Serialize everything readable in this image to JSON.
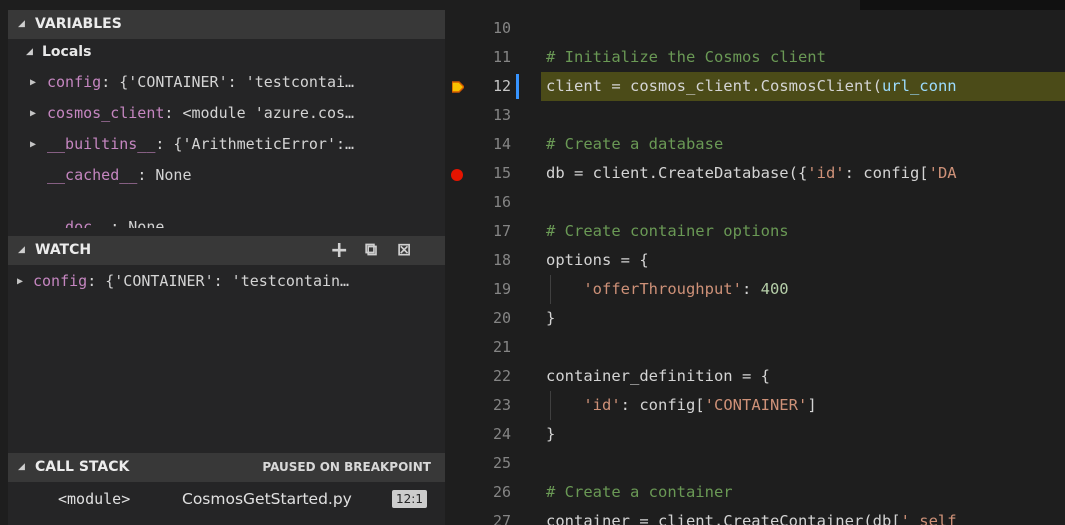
{
  "sidebar": {
    "variables": {
      "title": "VARIABLES",
      "locals_title": "Locals",
      "rows": [
        {
          "name": "config",
          "value": ": {'CONTAINER': 'testcontai…",
          "expandable": true
        },
        {
          "name": "cosmos_client",
          "value": ": <module 'azure.cos…",
          "expandable": true
        },
        {
          "name": "__builtins__",
          "value": ": {'ArithmeticError':…",
          "expandable": true
        },
        {
          "name": "__cached__",
          "value": ": None",
          "expandable": false
        },
        {
          "name": "__doc__",
          "value": ": None",
          "expandable": false
        }
      ]
    },
    "watch": {
      "title": "WATCH",
      "add_icon": "+",
      "collapse_icon": "⧉",
      "remove_icon": "⊠",
      "rows": [
        {
          "name": "config",
          "value": ": {'CONTAINER': 'testcontain…"
        }
      ]
    },
    "call_stack": {
      "title": "CALL STACK",
      "status": "PAUSED ON BREAKPOINT",
      "frame": {
        "function": "<module>",
        "file": "CosmosGetStarted.py",
        "line": "12:1"
      }
    }
  },
  "editor": {
    "current_line": 12,
    "breakpoint_line": 15,
    "lines": [
      {
        "num": "10",
        "tokens": []
      },
      {
        "num": "11",
        "tokens": [
          {
            "t": "# Initialize the Cosmos client",
            "c": "cm"
          }
        ]
      },
      {
        "num": "12",
        "tokens": [
          {
            "t": "client = cosmos_client.CosmosClient(",
            "c": ""
          },
          {
            "t": "url_conn",
            "c": "url"
          }
        ]
      },
      {
        "num": "13",
        "tokens": []
      },
      {
        "num": "14",
        "tokens": [
          {
            "t": "# Create a database",
            "c": "cm"
          }
        ]
      },
      {
        "num": "15",
        "tokens": [
          {
            "t": "db = client.CreateDatabase({",
            "c": ""
          },
          {
            "t": "'id'",
            "c": "st"
          },
          {
            "t": ": config[",
            "c": ""
          },
          {
            "t": "'DA",
            "c": "st"
          }
        ]
      },
      {
        "num": "16",
        "tokens": []
      },
      {
        "num": "17",
        "tokens": [
          {
            "t": "# Create container options",
            "c": "cm"
          }
        ]
      },
      {
        "num": "18",
        "tokens": [
          {
            "t": "options = {",
            "c": ""
          }
        ]
      },
      {
        "num": "19",
        "tokens": [
          {
            "t": "    ",
            "c": ""
          },
          {
            "t": "'offerThroughput'",
            "c": "st"
          },
          {
            "t": ": ",
            "c": ""
          },
          {
            "t": "400",
            "c": "nu"
          }
        ]
      },
      {
        "num": "20",
        "tokens": [
          {
            "t": "}",
            "c": ""
          }
        ]
      },
      {
        "num": "21",
        "tokens": []
      },
      {
        "num": "22",
        "tokens": [
          {
            "t": "container_definition = {",
            "c": ""
          }
        ]
      },
      {
        "num": "23",
        "tokens": [
          {
            "t": "    ",
            "c": ""
          },
          {
            "t": "'id'",
            "c": "st"
          },
          {
            "t": ": config[",
            "c": ""
          },
          {
            "t": "'CONTAINER'",
            "c": "st"
          },
          {
            "t": "]",
            "c": ""
          }
        ]
      },
      {
        "num": "24",
        "tokens": [
          {
            "t": "}",
            "c": ""
          }
        ]
      },
      {
        "num": "25",
        "tokens": []
      },
      {
        "num": "26",
        "tokens": [
          {
            "t": "# Create a container",
            "c": "cm"
          }
        ]
      },
      {
        "num": "27",
        "tokens": [
          {
            "t": "container = client.CreateContainer(db[",
            "c": ""
          },
          {
            "t": "'_self",
            "c": "st"
          }
        ]
      }
    ]
  },
  "colors": {
    "breakpoint": "#e51400",
    "current_line_highlight": "#4b4b18",
    "sidebar_bg": "#252526",
    "editor_bg": "#1e1e1e"
  }
}
